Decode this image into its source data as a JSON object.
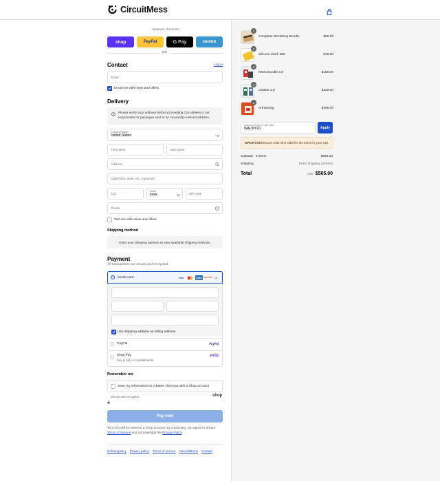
{
  "brand": {
    "name": "CircuitMess"
  },
  "express": {
    "label": "Express checkout",
    "buttons": [
      "shop",
      "PayPal",
      "G Pay",
      "venmo"
    ],
    "or": "OR"
  },
  "contact": {
    "title": "Contact",
    "login": "Log in",
    "email_placeholder": "Email",
    "newsletter_label": "Email me with news and offers"
  },
  "delivery": {
    "title": "Delivery",
    "notice": "Please verify your address before proceeding CircuitMess is not responsible for packages sent to an incorrectly entered address.",
    "country_label": "Country/Region",
    "country_value": "United States",
    "first_name": "First name",
    "last_name": "Last name",
    "address": "Address",
    "apartment": "Apartment, suite, etc. (optional)",
    "city": "City",
    "state_label": "State",
    "state_value": "Iowa",
    "zip": "ZIP code",
    "phone": "Phone",
    "text_offers": "Text me with news and offers"
  },
  "shipping": {
    "title": "Shipping method",
    "notice": "Enter your shipping address to view available shipping methods."
  },
  "payment": {
    "title": "Payment",
    "subtitle": "All transactions are secure and encrypted.",
    "credit_card": "Credit card",
    "card_logos": [
      "VISA",
      "MC",
      "AMEX",
      "DISCOVER",
      "+4"
    ],
    "billing_same": "Use shipping address as billing address",
    "paypal": "PayPal",
    "paypal_logo": "PayPal",
    "shop_pay": "Shop Pay",
    "shop_pay_sub": "Pay in full or in installments",
    "shop_pay_logo": "shop"
  },
  "remember": {
    "title": "Remember me",
    "save_label": "Save my information for a faster checkout with a Shop account",
    "secure": "Secure and encrypted",
    "shop_logo": "shop"
  },
  "pay_now": "Pay now",
  "legal": {
    "line1": "Your info will be saved to a Shop account. By continuing, you agree to Shop's",
    "terms": "Terms of Service",
    "and": "and acknowledge the",
    "privacy": "Privacy Policy",
    "dot": "."
  },
  "footer_links": [
    "Refund policy",
    "Privacy policy",
    "Terms of service",
    "Cancellations",
    "Contact"
  ],
  "cart": {
    "items": [
      {
        "name": "Complete Workshop Bundle",
        "qty": "1",
        "price": "$59.00",
        "img": "box-bundle"
      },
      {
        "name": "Silicone Work Mat",
        "qty": "1",
        "price": "$19.00",
        "img": "yellow-mat"
      },
      {
        "name": "Retro Bundle 2.0",
        "qty": "1",
        "price": "$169.00",
        "img": "retro-bundle"
      },
      {
        "name": "Chatter 2.0",
        "qty": "1",
        "price": "$129.00",
        "img": "chatter"
      },
      {
        "name": "Armstrong",
        "qty": "1",
        "price": "$169.00",
        "img": "armstrong"
      }
    ],
    "discount_label": "Discount code or gift card",
    "discount_value": "WACKY20",
    "apply": "Apply",
    "error_code": "WACKY20",
    "error_text": " discount code isn't valid for the items in your cart",
    "subtotal_label": "Subtotal · 5 items",
    "subtotal_value": "$565.00",
    "shipping_label": "Shipping",
    "shipping_value": "Enter shipping address",
    "total_label": "Total",
    "currency": "USD",
    "total_value": "$565.00"
  },
  "colors": {
    "accent": "#1f4fc7",
    "shop": "#5a31f4",
    "paypal": "#ffc439",
    "venmo": "#3d95ce",
    "pay_disabled": "#8cb0e8"
  }
}
